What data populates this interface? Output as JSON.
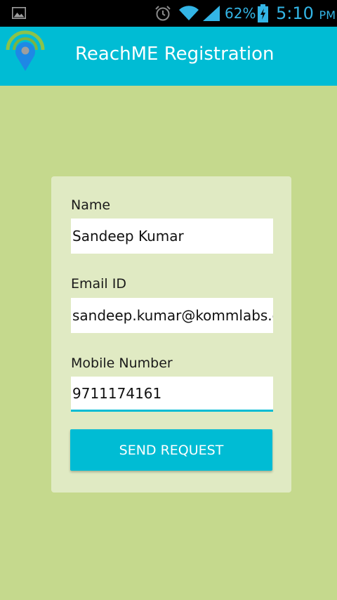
{
  "status_bar": {
    "battery_percent": "62%",
    "time": "5:10",
    "ampm": "PM",
    "icons": [
      "gallery-icon",
      "alarm-icon",
      "wifi-icon",
      "signal-icon",
      "battery-charging-icon"
    ]
  },
  "app_bar": {
    "title": "ReachME Registration",
    "logo": "location-pin-logo"
  },
  "form": {
    "name_label": "Name",
    "name_value": "Sandeep Kumar",
    "email_label": "Email ID",
    "email_value": "sandeep.kumar@kommlabs.co",
    "mobile_label": "Mobile Number",
    "mobile_value": "9711174161",
    "submit_label": "SEND REQUEST"
  },
  "colors": {
    "background": "#c5d98d",
    "app_bar": "#00bcd4",
    "card": "#e0eac3",
    "status_accent": "#33b5e5"
  }
}
